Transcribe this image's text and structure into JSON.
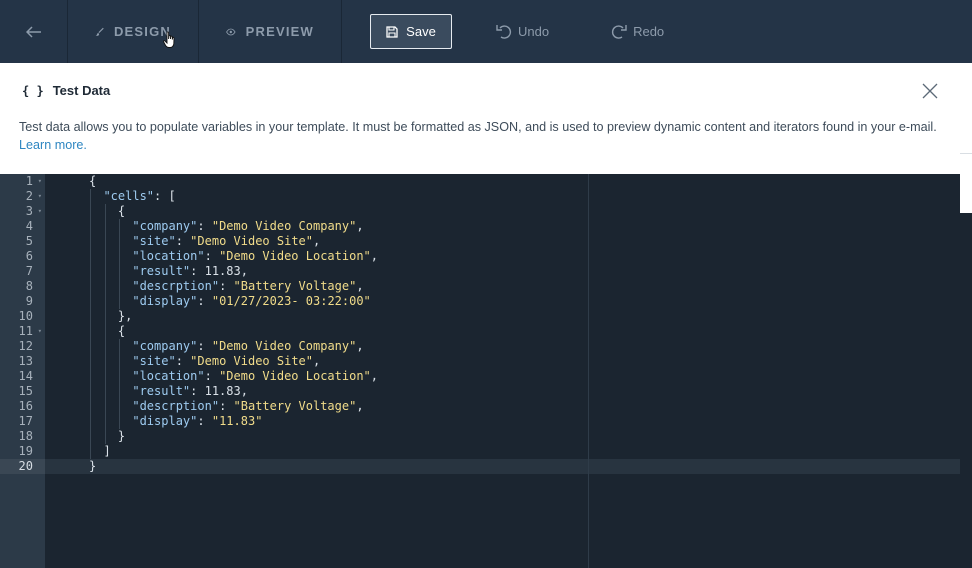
{
  "toolbar": {
    "design_label": "DESIGN",
    "preview_label": "PREVIEW",
    "save_label": "Save",
    "undo_label": "Undo",
    "redo_label": "Redo"
  },
  "panel": {
    "braces": "{ }",
    "title": "Test Data",
    "description": "Test data allows you to populate variables in your template. It must be formatted as JSON, and is used to preview dynamic content and iterators found in your e-mail.",
    "learn_more": "Learn more."
  },
  "editor": {
    "line_numbers": [
      "1",
      "2",
      "3",
      "4",
      "5",
      "6",
      "7",
      "8",
      "9",
      "10",
      "11",
      "12",
      "13",
      "14",
      "15",
      "16",
      "17",
      "18",
      "19",
      "20"
    ],
    "active_line": 20,
    "fold_lines": [
      1,
      2,
      3,
      11
    ],
    "lines": [
      {
        "indent": 0,
        "tokens": [
          [
            "p",
            "{"
          ]
        ]
      },
      {
        "indent": 1,
        "tokens": [
          [
            "k",
            "\"cells\""
          ],
          [
            "p",
            ": ["
          ]
        ]
      },
      {
        "indent": 2,
        "tokens": [
          [
            "p",
            "{"
          ]
        ]
      },
      {
        "indent": 3,
        "tokens": [
          [
            "k",
            "\"company\""
          ],
          [
            "p",
            ": "
          ],
          [
            "s",
            "\"Demo Video Company\""
          ],
          [
            "p",
            ","
          ]
        ]
      },
      {
        "indent": 3,
        "tokens": [
          [
            "k",
            "\"site\""
          ],
          [
            "p",
            ": "
          ],
          [
            "s",
            "\"Demo Video Site\""
          ],
          [
            "p",
            ","
          ]
        ]
      },
      {
        "indent": 3,
        "tokens": [
          [
            "k",
            "\"location\""
          ],
          [
            "p",
            ": "
          ],
          [
            "s",
            "\"Demo Video Location\""
          ],
          [
            "p",
            ","
          ]
        ]
      },
      {
        "indent": 3,
        "tokens": [
          [
            "k",
            "\"result\""
          ],
          [
            "p",
            ": "
          ],
          [
            "n",
            "11.83"
          ],
          [
            "p",
            ","
          ]
        ]
      },
      {
        "indent": 3,
        "tokens": [
          [
            "k",
            "\"descrption\""
          ],
          [
            "p",
            ": "
          ],
          [
            "s",
            "\"Battery Voltage\""
          ],
          [
            "p",
            ","
          ]
        ]
      },
      {
        "indent": 3,
        "tokens": [
          [
            "k",
            "\"display\""
          ],
          [
            "p",
            ": "
          ],
          [
            "s",
            "\"01/27/2023- 03:22:00\""
          ]
        ]
      },
      {
        "indent": 2,
        "tokens": [
          [
            "p",
            "},"
          ]
        ]
      },
      {
        "indent": 2,
        "tokens": [
          [
            "p",
            "{"
          ]
        ]
      },
      {
        "indent": 3,
        "tokens": [
          [
            "k",
            "\"company\""
          ],
          [
            "p",
            ": "
          ],
          [
            "s",
            "\"Demo Video Company\""
          ],
          [
            "p",
            ","
          ]
        ]
      },
      {
        "indent": 3,
        "tokens": [
          [
            "k",
            "\"site\""
          ],
          [
            "p",
            ": "
          ],
          [
            "s",
            "\"Demo Video Site\""
          ],
          [
            "p",
            ","
          ]
        ]
      },
      {
        "indent": 3,
        "tokens": [
          [
            "k",
            "\"location\""
          ],
          [
            "p",
            ": "
          ],
          [
            "s",
            "\"Demo Video Location\""
          ],
          [
            "p",
            ","
          ]
        ]
      },
      {
        "indent": 3,
        "tokens": [
          [
            "k",
            "\"result\""
          ],
          [
            "p",
            ": "
          ],
          [
            "n",
            "11.83"
          ],
          [
            "p",
            ","
          ]
        ]
      },
      {
        "indent": 3,
        "tokens": [
          [
            "k",
            "\"descrption\""
          ],
          [
            "p",
            ": "
          ],
          [
            "s",
            "\"Battery Voltage\""
          ],
          [
            "p",
            ","
          ]
        ]
      },
      {
        "indent": 3,
        "tokens": [
          [
            "k",
            "\"display\""
          ],
          [
            "p",
            ": "
          ],
          [
            "s",
            "\"11.83\""
          ]
        ]
      },
      {
        "indent": 2,
        "tokens": [
          [
            "p",
            "}"
          ]
        ]
      },
      {
        "indent": 1,
        "tokens": [
          [
            "p",
            "]"
          ]
        ]
      },
      {
        "indent": 0,
        "tokens": [
          [
            "p",
            "}"
          ]
        ]
      }
    ]
  },
  "colors": {
    "toolbar_bg": "#243447",
    "editor_bg": "#1b2530",
    "json_key": "#9ecbf0",
    "json_string": "#f1dc8a",
    "link": "#2e86c1"
  },
  "icons": {
    "back": "arrow-left-icon",
    "design": "brush-icon",
    "preview": "eye-icon",
    "save": "floppy-disk-icon",
    "undo": "undo-icon",
    "redo": "redo-icon",
    "close": "close-icon",
    "cursor": "hand-pointer-icon"
  }
}
